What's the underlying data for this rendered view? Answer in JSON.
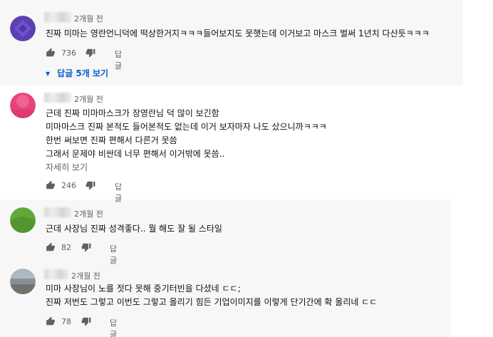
{
  "comments": [
    {
      "time": "2개월 전",
      "lines": [
        "진짜 미마는 영란언니덕에 떡상한거지ㅋㅋㅋ들어보지도 못햇는데 이거보고 마스크 벌써 1년치 다산듯ㅋㅋㅋ"
      ],
      "likes": "736",
      "reply_label": "답글",
      "replies_toggle": "답글 5개 보기",
      "avatar_color": "#5b3fb4"
    },
    {
      "time": "2개월 전",
      "lines": [
        "근데 진짜 미마마스크가 장영란님 덕 많이 보긴함",
        "미마마스크 진짜 본적도 들어본적도 없는데 이거 보자마자 나도 샀으니까ㅋㅋㅋ",
        "한번 써보면 진짜 편해서 다른거 못씀",
        "그래서 문제야 비싼데 너무 편해서 이거밖에 못씀.."
      ],
      "show_more": "자세히 보기",
      "likes": "246",
      "reply_label": "답글",
      "avatar_color": "#e8427c"
    },
    {
      "time": "2개월 전",
      "lines": [
        "근데 사장님 진짜 성격좋다.. 뭘 해도 잘 될 스타일"
      ],
      "likes": "82",
      "reply_label": "답글",
      "avatar_color": "#5fa83a"
    },
    {
      "time": "2개월 전",
      "lines": [
        "미마 사장님이 노를 젓다 못해 중기터빈을 다셨네 ㄷㄷ;",
        "진짜 저번도 그렇고 이번도 그렇고 올리기 힘든 기업이미지를 이렇게 단기간에 확 올리네 ㄷㄷ"
      ],
      "likes": "78",
      "reply_label": "답글",
      "avatar_color": "#8a8f96"
    }
  ],
  "colors": {
    "link": "#065fd4",
    "muted": "#606060",
    "band_gray": "#f4f4f4"
  },
  "icons": [
    "thumbs-up-icon",
    "thumbs-down-icon",
    "caret-down-icon"
  ]
}
